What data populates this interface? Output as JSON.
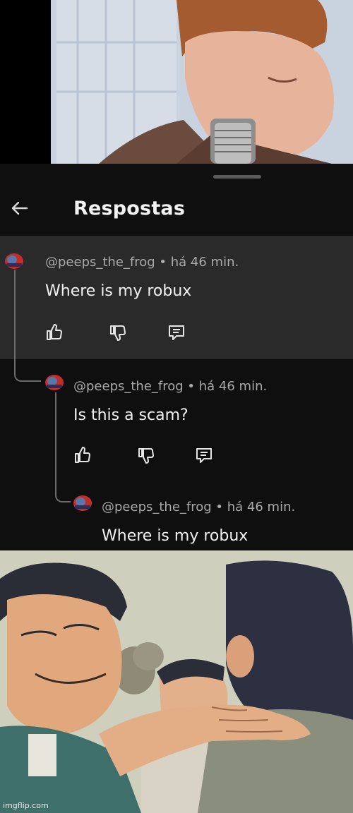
{
  "header": {
    "title": "Respostas"
  },
  "comments": [
    {
      "meta": "@peeps_the_frog • há 46 min.",
      "text": "Where is my robux"
    },
    {
      "meta": "@peeps_the_frog • há 46 min.",
      "text": "Is this a scam?"
    },
    {
      "meta": "@peeps_the_frog • há 46 min.",
      "text": "Where is my robux"
    }
  ],
  "icons": {
    "back": "arrow-left-icon",
    "like": "thumbs-up-icon",
    "dislike": "thumbs-down-icon",
    "reply": "comment-reply-icon"
  },
  "watermark": "imgflip.com",
  "colors": {
    "panel_bg": "#0f0f10",
    "highlight_bg": "#2a2a2a",
    "meta_text": "#a9a9a9",
    "body_text": "#f1f1f1"
  }
}
